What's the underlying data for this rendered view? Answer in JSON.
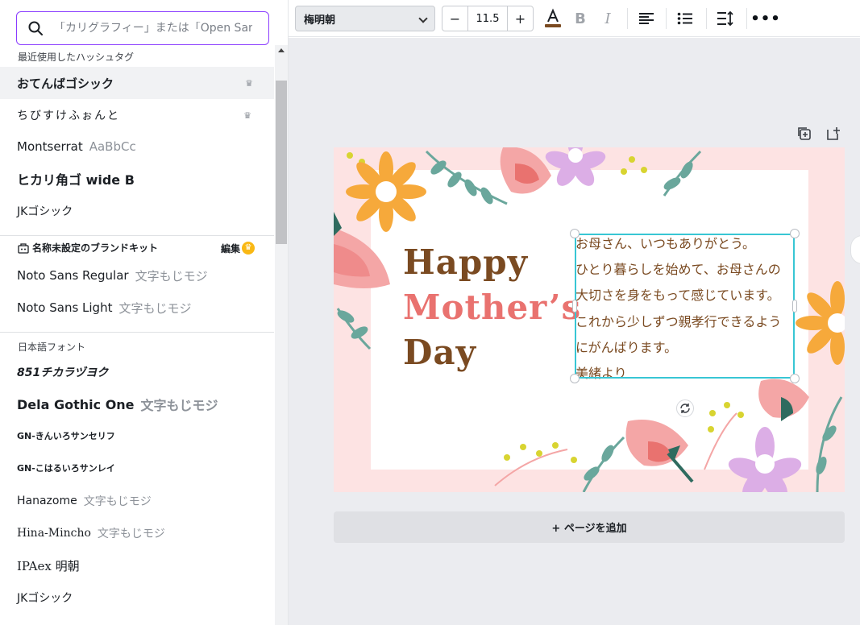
{
  "search": {
    "placeholder": "「カリグラフィー」または「Open Sans」"
  },
  "sections": {
    "recent": "最近使用したハッシュタグ",
    "brand": "名称未設定のブランドキット",
    "brand_edit": "編集",
    "japanese": "日本語フォント"
  },
  "recent_fonts": [
    {
      "name": "おてんばゴシック",
      "sample": "",
      "premium": true
    },
    {
      "name": "ちびすけふぉんと",
      "sample": "",
      "premium": true
    },
    {
      "name": "Montserrat",
      "sample": "AaBbCc",
      "premium": false
    },
    {
      "name": "ヒカリ角ゴ wide B",
      "sample": "",
      "premium": false
    },
    {
      "name": "JKゴシック",
      "sample": "",
      "premium": false
    }
  ],
  "brand_fonts": [
    {
      "name": "Noto Sans Regular",
      "sample": "文字もじモジ"
    },
    {
      "name": "Noto Sans Light",
      "sample": "文字もじモジ"
    }
  ],
  "japanese_fonts": [
    {
      "name": "851チカラヅヨク",
      "sample": ""
    },
    {
      "name": "Dela Gothic One",
      "sample": "文字もじモジ"
    },
    {
      "name": "GN-きんいろサンセリフ",
      "sample": ""
    },
    {
      "name": "GN-こはるいろサンレイ",
      "sample": ""
    },
    {
      "name": "Hanazome",
      "sample": "文字もじモジ"
    },
    {
      "name": "Hina-Mincho",
      "sample": "文字もじモジ"
    },
    {
      "name": "IPAex 明朝",
      "sample": ""
    },
    {
      "name": "JKゴシック",
      "sample": ""
    }
  ],
  "toolbar": {
    "font_name": "梅明朝",
    "font_size": "11.5",
    "minus": "−",
    "plus": "+",
    "text_color": "#7a4a21"
  },
  "card": {
    "happy": "Happy",
    "mothers": "Mother’s",
    "day": "Day",
    "message": [
      "お母さん、いつもありがとう。",
      "ひとり暮らしを始めて、お母さんの",
      "大切さを身をもって感じています。",
      "これから少しずつ親孝行できるよう",
      "にがんばります。",
      "美緒より"
    ]
  },
  "add_page_label": "+ ページを追加",
  "colors": {
    "accent": "#8b3dff",
    "selection": "#38c6d4",
    "card_bg": "#fde3e3",
    "title_brown": "#7a4a21",
    "title_pink": "#e9726f"
  }
}
